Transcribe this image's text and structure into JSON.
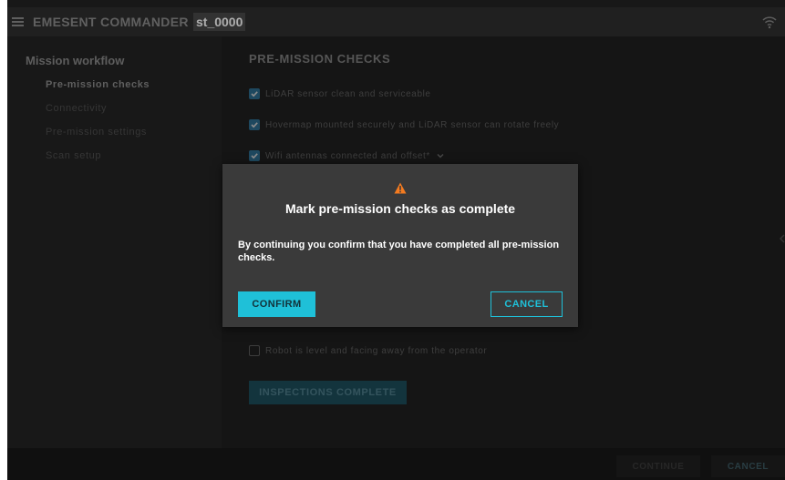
{
  "header": {
    "app_title": "EMESENT COMMANDER",
    "device_name": "st_0000",
    "menu_icon": "hamburger-menu-icon",
    "status_icon": "wifi-icon"
  },
  "sidebar": {
    "heading": "Mission workflow",
    "items": [
      {
        "label": "Pre-mission checks",
        "active": true
      },
      {
        "label": "Connectivity",
        "active": false
      },
      {
        "label": "Pre-mission settings",
        "active": false
      },
      {
        "label": "Scan setup",
        "active": false
      }
    ]
  },
  "main": {
    "section_title": "PRE-MISSION CHECKS",
    "checks": [
      {
        "label": "LiDAR sensor clean and serviceable",
        "checked": true
      },
      {
        "label": "Hovermap mounted securely and LiDAR sensor can rotate freely",
        "checked": true
      },
      {
        "label": "Wifi antennas connected and offset*",
        "checked": true,
        "expandable": true
      },
      {
        "label": "Robot is level and facing away from the operator",
        "checked": false
      }
    ],
    "inspections_button": "INSPECTIONS COMPLETE"
  },
  "footer": {
    "continue_label": "CONTINUE",
    "cancel_label": "CANCEL"
  },
  "dialog": {
    "icon": "warning-icon",
    "title": "Mark pre-mission checks as complete",
    "message": "By continuing you confirm that you have completed all pre-mission checks.",
    "confirm_label": "CONFIRM",
    "cancel_label": "CANCEL"
  },
  "colors": {
    "accent": "#1fc0d8",
    "checkbox_checked": "#2d6a8d",
    "warning": "#f47b20"
  }
}
